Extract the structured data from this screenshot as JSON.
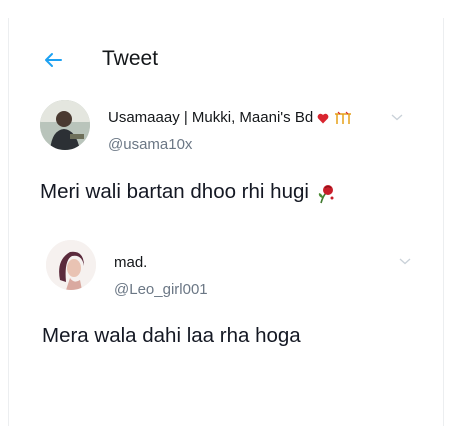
{
  "header": {
    "title": "Tweet",
    "back_icon": "arrow-left-icon",
    "accent_color": "#1da1f2"
  },
  "tweets": [
    {
      "display_name": "Usamaaay | Mukki, Maani's Bd",
      "display_name_emojis": [
        "heart-icon",
        "sparkle-gift-icon"
      ],
      "handle": "@usama10x",
      "text": "Meri wali bartan dhoo rhi hugi",
      "text_emoji": "wilted-rose-icon",
      "menu_icon": "chevron-down-icon"
    },
    {
      "display_name": "mad.",
      "handle": "@Leo_girl001",
      "text": "Mera wala dahi laa rha hoga",
      "menu_icon": "chevron-down-icon"
    }
  ]
}
